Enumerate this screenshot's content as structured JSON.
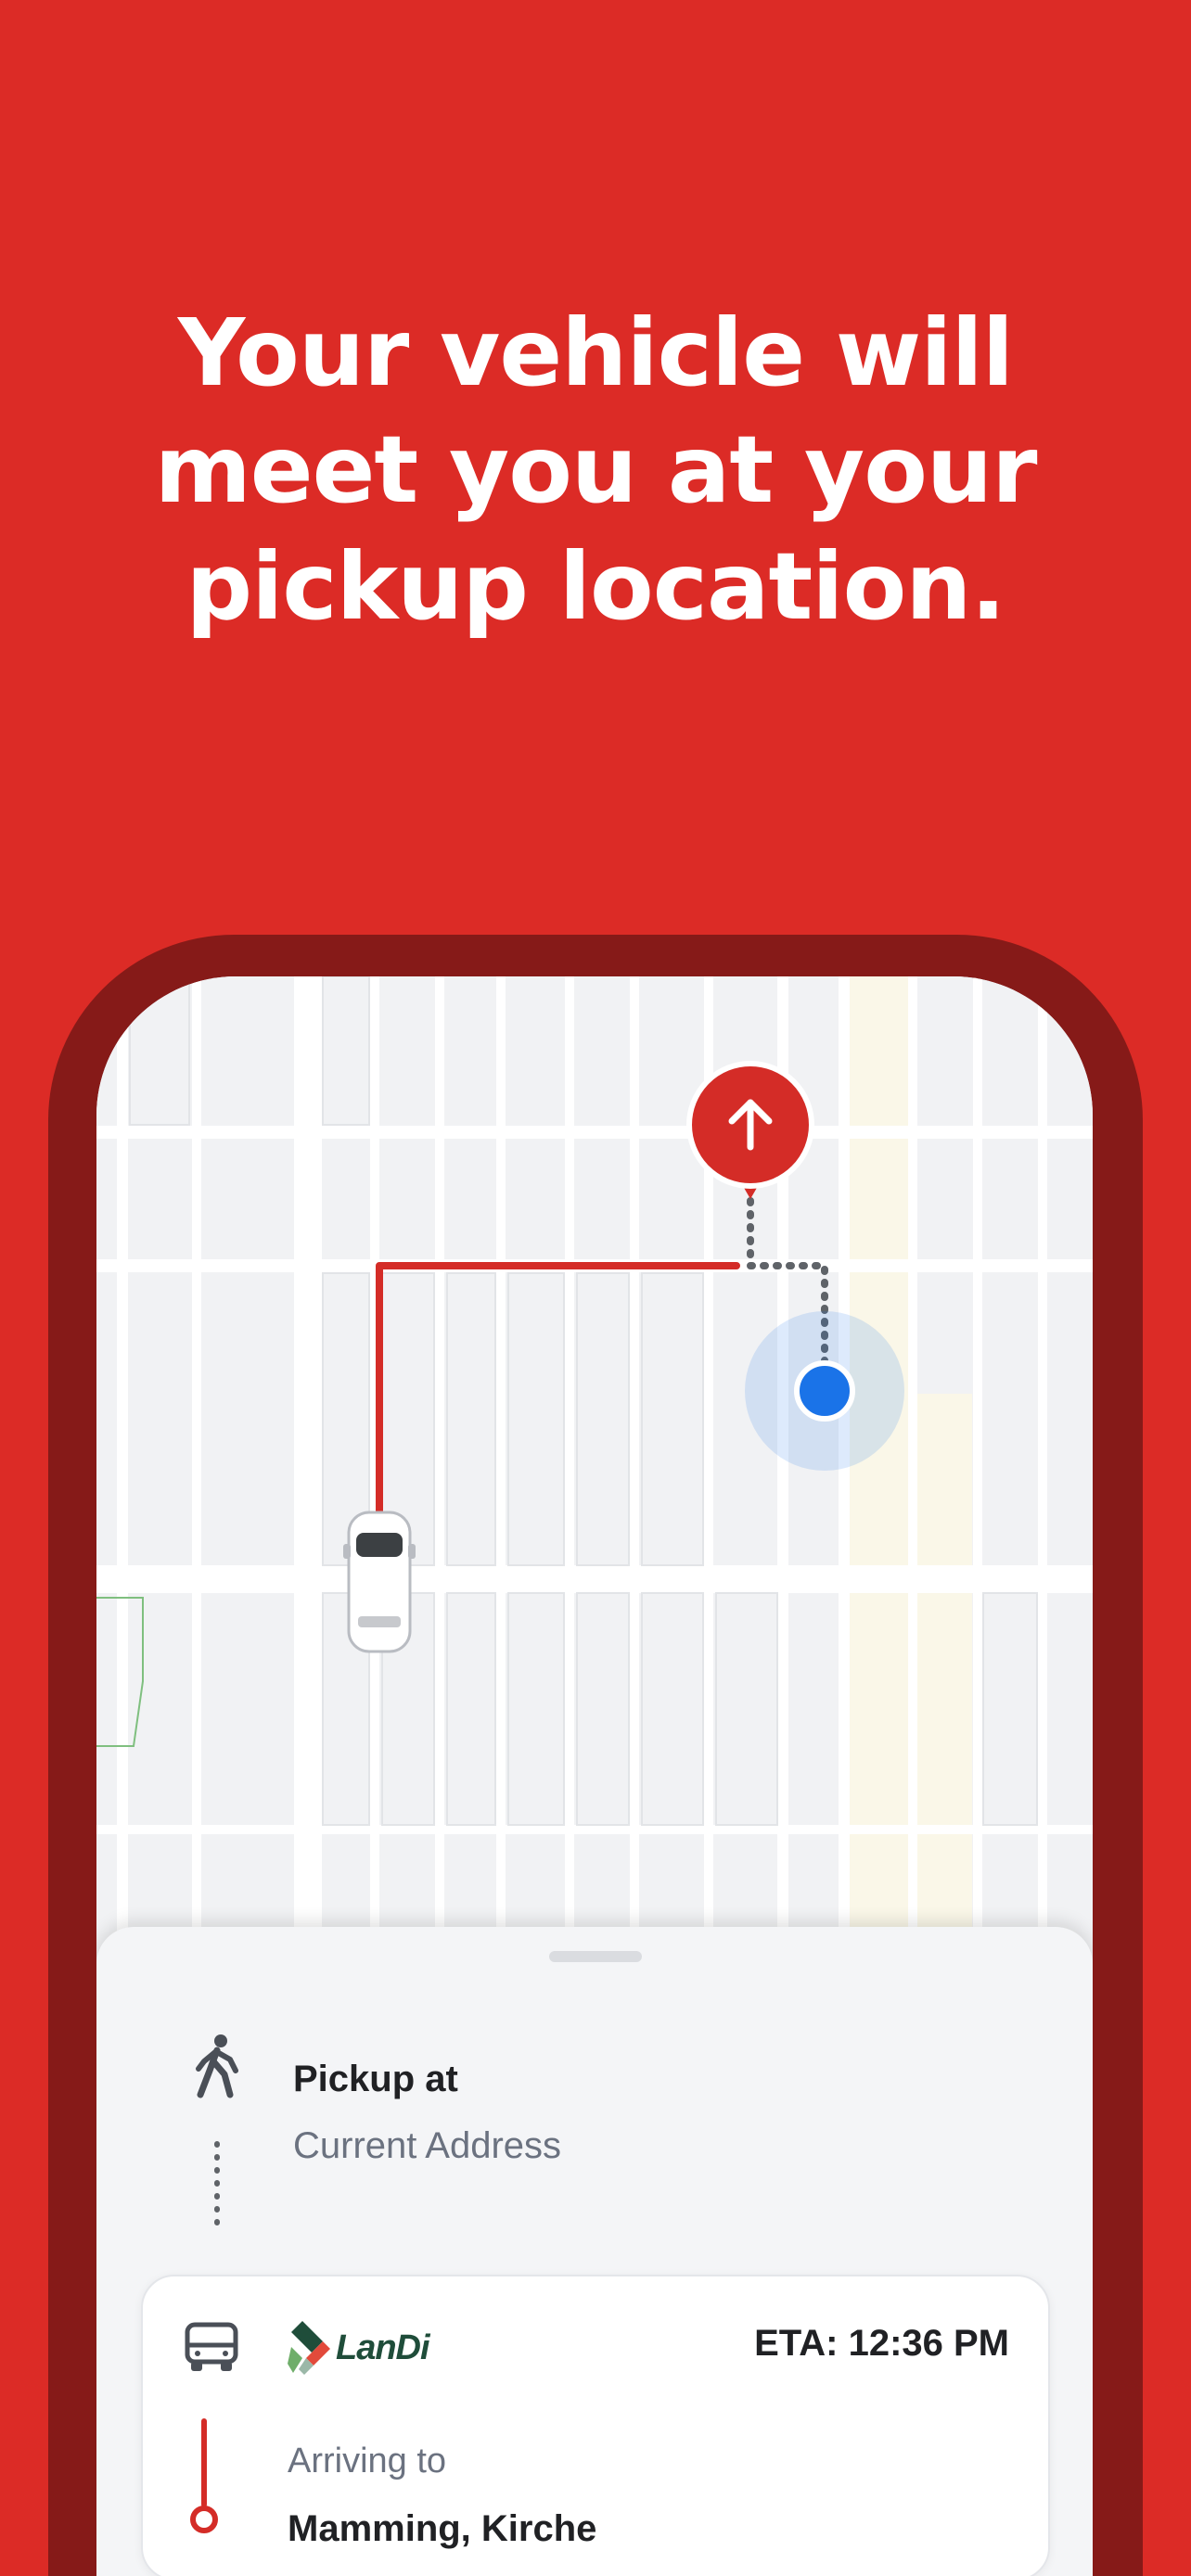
{
  "headline": {
    "line1": "Your vehicle will",
    "line2": "meet you at your",
    "line3": "pickup location."
  },
  "colors": {
    "background": "#DC2B26",
    "phone_frame": "#861A18",
    "route": "#D42C27",
    "user_dot": "#1A73E8"
  },
  "map": {
    "pickup_pin_icon": "arrow-up-icon",
    "vehicle_icon": "van-top-view-icon",
    "user_location_icon": "blue-dot-icon"
  },
  "pickup": {
    "label": "Pickup at",
    "address": "Current Address",
    "icon": "walking-person-icon"
  },
  "ride_card": {
    "vehicle_icon": "van-icon",
    "brand": "LanDi",
    "eta": "ETA: 12:36 PM",
    "arriving_label": "Arriving to",
    "destination": "Mamming, Kirche"
  }
}
